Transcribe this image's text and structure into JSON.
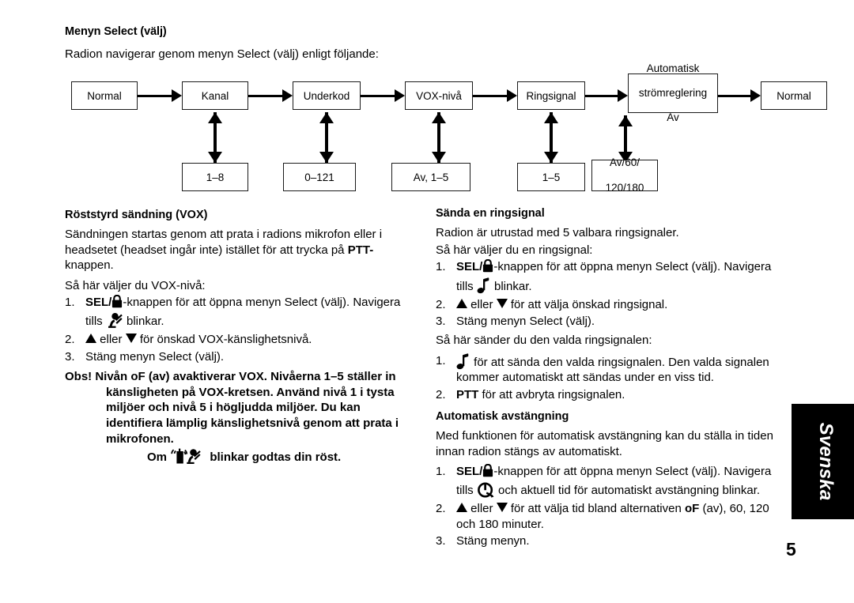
{
  "section_menu": {
    "title": "Menyn Select (välj)",
    "intro": "Radion navigerar genom menyn Select (välj) enligt följande:"
  },
  "flowchart": {
    "type": "flow",
    "top_row": [
      "Normal",
      "Kanal",
      "Underkod",
      "VOX-nivå",
      "Ringsignal",
      "Automatisk strömreglering Av",
      "Normal"
    ],
    "top_row_lines": [
      [
        "Normal"
      ],
      [
        "Kanal"
      ],
      [
        "Underkod"
      ],
      [
        "VOX-nivå"
      ],
      [
        "Ringsignal"
      ],
      [
        "Automatisk",
        "strömreglering",
        "Av"
      ],
      [
        "Normal"
      ]
    ],
    "bottom_row_lines": [
      [
        "1–8"
      ],
      [
        "0–121"
      ],
      [
        "Av, 1–5"
      ],
      [
        "1–5"
      ],
      [
        "Av/60/",
        "120/180"
      ]
    ]
  },
  "vox": {
    "title": "Röststyrd sändning (VOX)",
    "intro_1": "Sändningen startas genom att prata i radions mikrofon eller i headsetet (headset ingår inte) istället för att trycka på ",
    "intro_1_bold": "PTT-",
    "intro_1_tail": "knappen.",
    "intro_2": "Så här väljer du VOX-nivå:",
    "step1_num": "1.",
    "step1_bold": "SEL/",
    "step1_text": "-knappen för att öppna menyn Select (välj). Navigera",
    "step1_sub_pre": "tills ",
    "step1_sub_post": " blinkar.",
    "step2_num": "2.",
    "step2_mid": " eller ",
    "step2_text": " för önskad VOX-känslighetsnivå.",
    "step3_num": "3.",
    "step3_text": "Stäng menyn Select (välj).",
    "note_label": "Obs!",
    "note_body": "Nivån oF (av) avaktiverar VOX. Nivåerna 1–5 ställer in känsligheten på VOX-kretsen. Använd nivå 1 i tysta miljöer och nivå 5 i högljudda miljöer. Du kan identifiera lämplig känslighetsnivå genom att prata i mikrofonen.",
    "note_last_pre": "Om ",
    "note_last_post": " blinkar godtas din röst."
  },
  "ringsignal": {
    "title": "Sända en ringsignal",
    "intro_1": "Radion är utrustad med 5 valbara ringsignaler.",
    "intro_2": "Så här väljer du en ringsignal:",
    "step1_num": "1.",
    "step1_bold": "SEL/",
    "step1_text": "-knappen för att öppna menyn Select (välj). Navigera",
    "step1_sub_pre": "tills ",
    "step1_sub_post": " blinkar.",
    "step2_num": "2.",
    "step2_mid": " eller ",
    "step2_text": " för att välja önskad ringsignal.",
    "step3_num": "3.",
    "step3_text": "Stäng menyn Select (välj).",
    "send_intro": "Så här sänder du den valda ringsignalen:",
    "send1_num": "1.",
    "send1_text": " för att sända den valda ringsignalen. Den valda signalen kommer automatiskt att sändas under en viss tid.",
    "send2_num": "2.",
    "send2_bold": "PTT",
    "send2_text": " för att avbryta ringsignalen."
  },
  "auto_off": {
    "title": "Automatisk avstängning",
    "intro": "Med funktionen för automatisk avstängning kan du ställa in tiden innan radion stängs av automatiskt.",
    "step1_num": "1.",
    "step1_bold": "SEL/",
    "step1_text": "-knappen för att öppna menyn Select (välj). Navigera",
    "step1_sub_pre": "tills ",
    "step1_sub_post": " och aktuell tid för automatiskt avstängning blinkar.",
    "step2_num": "2.",
    "step2_mid": " eller ",
    "step2_text_a": " för att välja tid bland alternativen ",
    "step2_bold": "oF",
    "step2_text_b": " (av), 60, 120 och 180 minuter.",
    "step3_num": "3.",
    "step3_text": "Stäng menyn."
  },
  "side_tab": {
    "label": "Svenska"
  },
  "footer": {
    "page_number": "5"
  },
  "icons": {
    "lock": "lock-icon",
    "mic_person": "vox-person-icon",
    "radio_talk": "radio-talking-icon",
    "note": "music-note-icon",
    "power": "power-icon",
    "up": "triangle-up-icon",
    "down": "triangle-down-icon"
  },
  "colors": {
    "ink": "#000000",
    "paper": "#ffffff",
    "tab_bg": "#000000",
    "tab_text": "#ffffff"
  }
}
